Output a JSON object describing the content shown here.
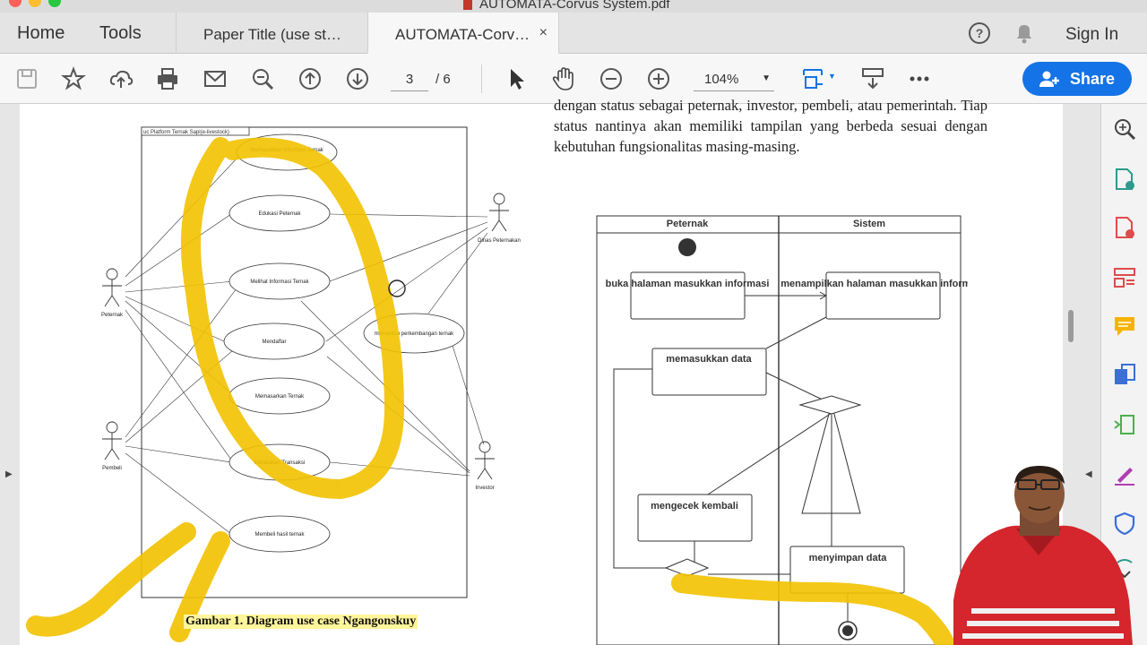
{
  "window": {
    "title": "AUTOMATA-Corvus System.pdf"
  },
  "header": {
    "home_label": "Home",
    "tools_label": "Tools",
    "tabs": [
      {
        "label": "Paper Title (use st…"
      },
      {
        "label": "AUTOMATA-Corv…",
        "close": "×"
      }
    ],
    "help_icon": "help-circle-icon",
    "bell_icon": "bell-icon",
    "signin_label": "Sign In"
  },
  "toolbar": {
    "page_current": "3",
    "page_total": "/ 6",
    "zoom": "104%",
    "share_label": "Share",
    "accent": "#1473e6"
  },
  "document": {
    "body_text": "dengan status sebagai peternak, investor, pembeli, atau pemerintah. Tiap status nantinya akan memiliki tampilan yang berbeda sesuai dengan kebutuhan fungsionalitas masing-masing.",
    "figure_caption": "Gambar 1. Diagram use case Ngangonskuy",
    "usecase": {
      "system_label": "uc Platform Ternak Sapi(e-livestock)",
      "actors": [
        "Peternak",
        "Pembeli",
        "Dinas Peternakan",
        "Investor"
      ],
      "usecases": [
        "Memasukkan Informasi Ternak",
        "Edukasi Peternak",
        "Melihat Informasi Ternak",
        "Mendaftar",
        "Memasarkan Ternak",
        "Melakukan Transaksi",
        "Membeli hasil ternak",
        "memantau perkembangan ternak"
      ]
    },
    "activity": {
      "lanes": [
        "Peternak",
        "Sistem"
      ],
      "actions": [
        "buka halaman masukkan informasi",
        "menampilkan halaman masukkan informasi",
        "memasukkan data",
        "mengecek kembali",
        "menyimpan data"
      ]
    },
    "highlight_color": "#f2c200"
  }
}
